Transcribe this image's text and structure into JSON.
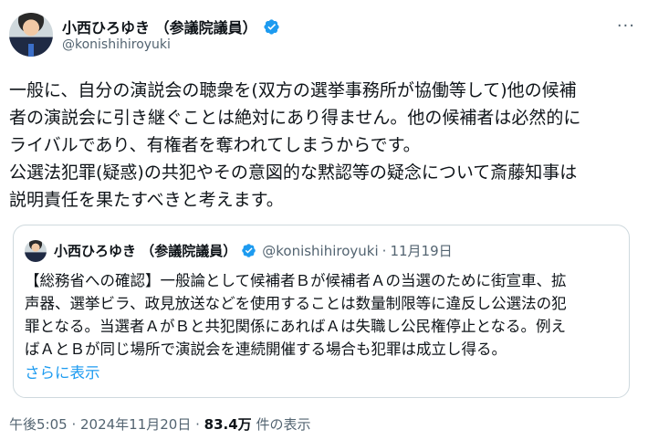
{
  "author": {
    "display_name": "小西ひろゆき （参議院議員）",
    "handle": "@konishihiroyuki",
    "verified_color": "#1d9bf0",
    "more_label": "···"
  },
  "tweet": {
    "lines": [
      "一般に、自分の演説会の聴衆を(双方の選挙事務所が協働等して)他の候補",
      "者の演説会に引き継ぐことは絶対にあり得ません。他の候補者は必然的に",
      "ライバルであり、有権者を奪われてしまうからです。",
      "公選法犯罪(疑惑)の共犯やその意図的な黙認等の疑念について斎藤知事は",
      "説明責任を果たすべきと考えます。"
    ]
  },
  "quote": {
    "display_name": "小西ひろゆき （参議院議員）",
    "handle": "@konishihiroyuki",
    "separator": "·",
    "date": "11月19日",
    "lines": [
      "【総務省への確認】一般論として候補者Ｂが候補者Ａの当選のために街宣車、拡",
      "声器、選挙ビラ、政見放送などを使用することは数量制限等に違反し公選法の犯",
      "罪となる。当選者ＡがＢと共犯関係にあればＡは失職し公民権停止となる。例え",
      "ばＡとＢが同じ場所で演説会を連続開催する場合も犯罪は成立し得る。"
    ],
    "show_more": "さらに表示"
  },
  "meta": {
    "time": "午後5:05",
    "sep1": " · ",
    "date": "2024年11月20日",
    "sep2": " · ",
    "views_count": "83.4万",
    "views_label": " 件の表示"
  }
}
